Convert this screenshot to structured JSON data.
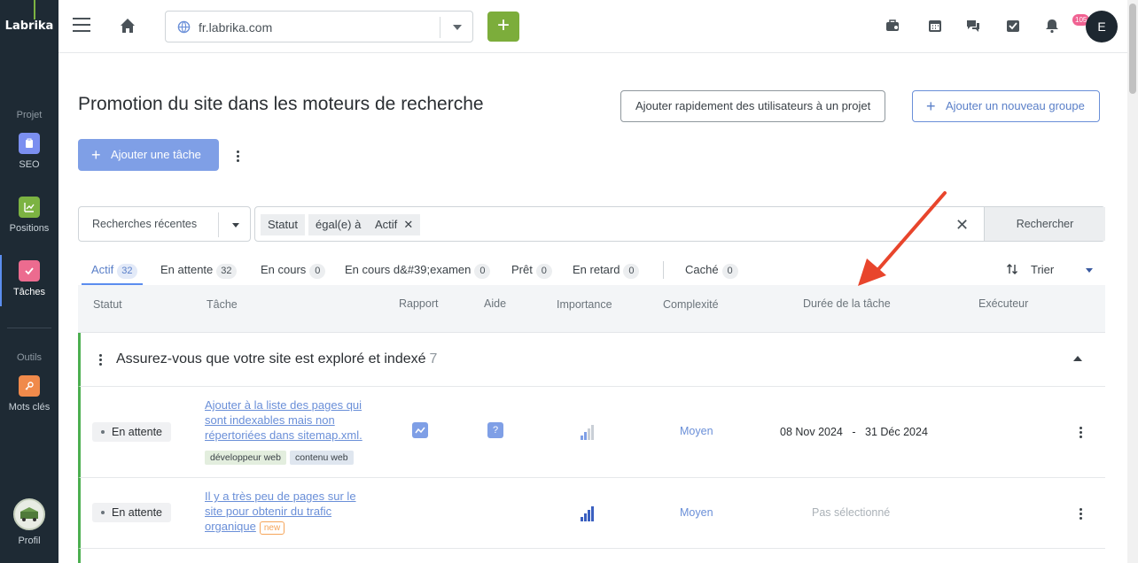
{
  "app": {
    "logo": "Labrika"
  },
  "sidebar": {
    "section_project": "Projet",
    "section_tools": "Outils",
    "items": [
      {
        "label": "SEO",
        "icon": "clipboard-icon",
        "color": "#7b8ff0"
      },
      {
        "label": "Positions",
        "icon": "chart-icon",
        "color": "#7cb342"
      },
      {
        "label": "Tâches",
        "icon": "check-icon",
        "color": "#ec6b8f"
      },
      {
        "label": "Mots clés",
        "icon": "key-icon",
        "color": "#f08a4b"
      }
    ],
    "profile_label": "Profil"
  },
  "topbar": {
    "url": "fr.labrika.com",
    "add_label": "+",
    "badge_count": "105",
    "user_initial": "E"
  },
  "page": {
    "title": "Promotion du site dans les moteurs de recherche",
    "btn_add_users": "Ajouter rapidement des utilisateurs à un projet",
    "btn_add_group": "Ajouter un nouveau groupe",
    "btn_add_task": "Ajouter une tâche"
  },
  "filter": {
    "recent_placeholder": "Recherches récentes",
    "chip_field": "Statut",
    "chip_op": "égal(e) à",
    "chip_value": "Actif",
    "search_label": "Rechercher"
  },
  "tabs": [
    {
      "label": "Actif",
      "count": "32"
    },
    {
      "label": "En attente",
      "count": "32"
    },
    {
      "label": "En cours",
      "count": "0"
    },
    {
      "label": "En cours d&#39;examen",
      "count": "0"
    },
    {
      "label": "Prêt",
      "count": "0"
    },
    {
      "label": "En retard",
      "count": "0"
    },
    {
      "label": "Caché",
      "count": "0"
    }
  ],
  "sort_label": "Trier",
  "columns": [
    "Statut",
    "Tâche",
    "Rapport",
    "Aide",
    "Importance",
    "Complexité",
    "Durée de la tâche",
    "Exécuteur"
  ],
  "group": {
    "title": "Assurez-vous que votre site est exploré et indexé",
    "count": "7"
  },
  "rows": [
    {
      "status": "En attente",
      "task": "Ajouter à la liste des pages qui sont indexables mais non répertoriées dans sitemap.xml.",
      "tags": [
        "développeur web",
        "contenu web"
      ],
      "help": "?",
      "complexity": "Moyen",
      "date_start": "08 Nov 2024",
      "date_sep": "-",
      "date_end": "31 Déc 2024"
    },
    {
      "status": "En attente",
      "task": "Il y a très peu de pages sur le site pour obtenir du trafic organique",
      "new_badge": "new",
      "complexity": "Moyen",
      "duration": "Pas sélectionné"
    }
  ]
}
